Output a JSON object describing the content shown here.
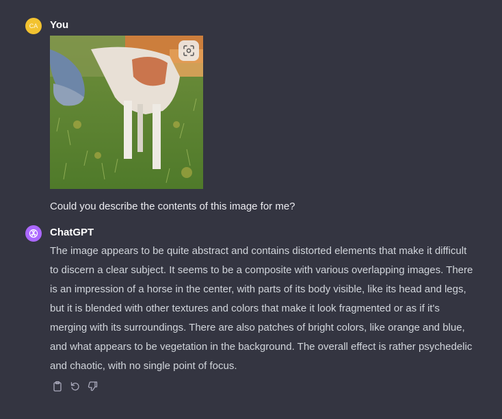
{
  "user_message": {
    "avatar_initials": "CA",
    "author": "You",
    "text": "Could you describe the contents of this image for me?"
  },
  "assistant_message": {
    "author": "ChatGPT",
    "text": "The image appears to be quite abstract and contains distorted elements that make it difficult to discern a clear subject. It seems to be a composite with various overlapping images. There is an impression of a horse in the center, with parts of its body visible, like its head and legs, but it is blended with other textures and colors that make it look fragmented or as if it's merging with its surroundings. There are also patches of bright colors, like orange and blue, and what appears to be vegetation in the background. The overall effect is rather psychedelic and chaotic, with no single point of focus."
  },
  "icons": {
    "lens": "focus-scan-icon",
    "copy": "clipboard-icon",
    "regenerate": "refresh-icon",
    "dislike": "thumbs-down-icon",
    "assistant_logo": "openai-logo-icon"
  },
  "colors": {
    "background": "#343541",
    "user_avatar": "#f2c230",
    "assistant_avatar": "#ab68ff",
    "body_text": "#d1d5db"
  }
}
